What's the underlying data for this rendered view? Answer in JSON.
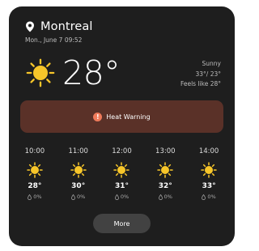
{
  "location": {
    "city": "Montreal",
    "datetime": "Mon., June 7 09:52",
    "icon": "location-pin-icon"
  },
  "current": {
    "temperature": "28°",
    "condition": "Sunny",
    "high_low": "33°/ 23°",
    "feels_like": "Feels like 28°",
    "icon": "sun-icon"
  },
  "alert": {
    "label": "Heat Warning",
    "icon": "alert-icon"
  },
  "hourly": [
    {
      "time": "10:00",
      "temp": "28°",
      "precip": "0%"
    },
    {
      "time": "11:00",
      "temp": "30°",
      "precip": "0%"
    },
    {
      "time": "12:00",
      "temp": "31°",
      "precip": "0%"
    },
    {
      "time": "13:00",
      "temp": "32°",
      "precip": "0%"
    },
    {
      "time": "14:00",
      "temp": "33°",
      "precip": "0%"
    }
  ],
  "more_button": {
    "label": "More"
  },
  "colors": {
    "card_background": "#1e1e1e",
    "alert_background": "#5a3128",
    "sun": "#f7c62a",
    "more_button": "#424242"
  }
}
